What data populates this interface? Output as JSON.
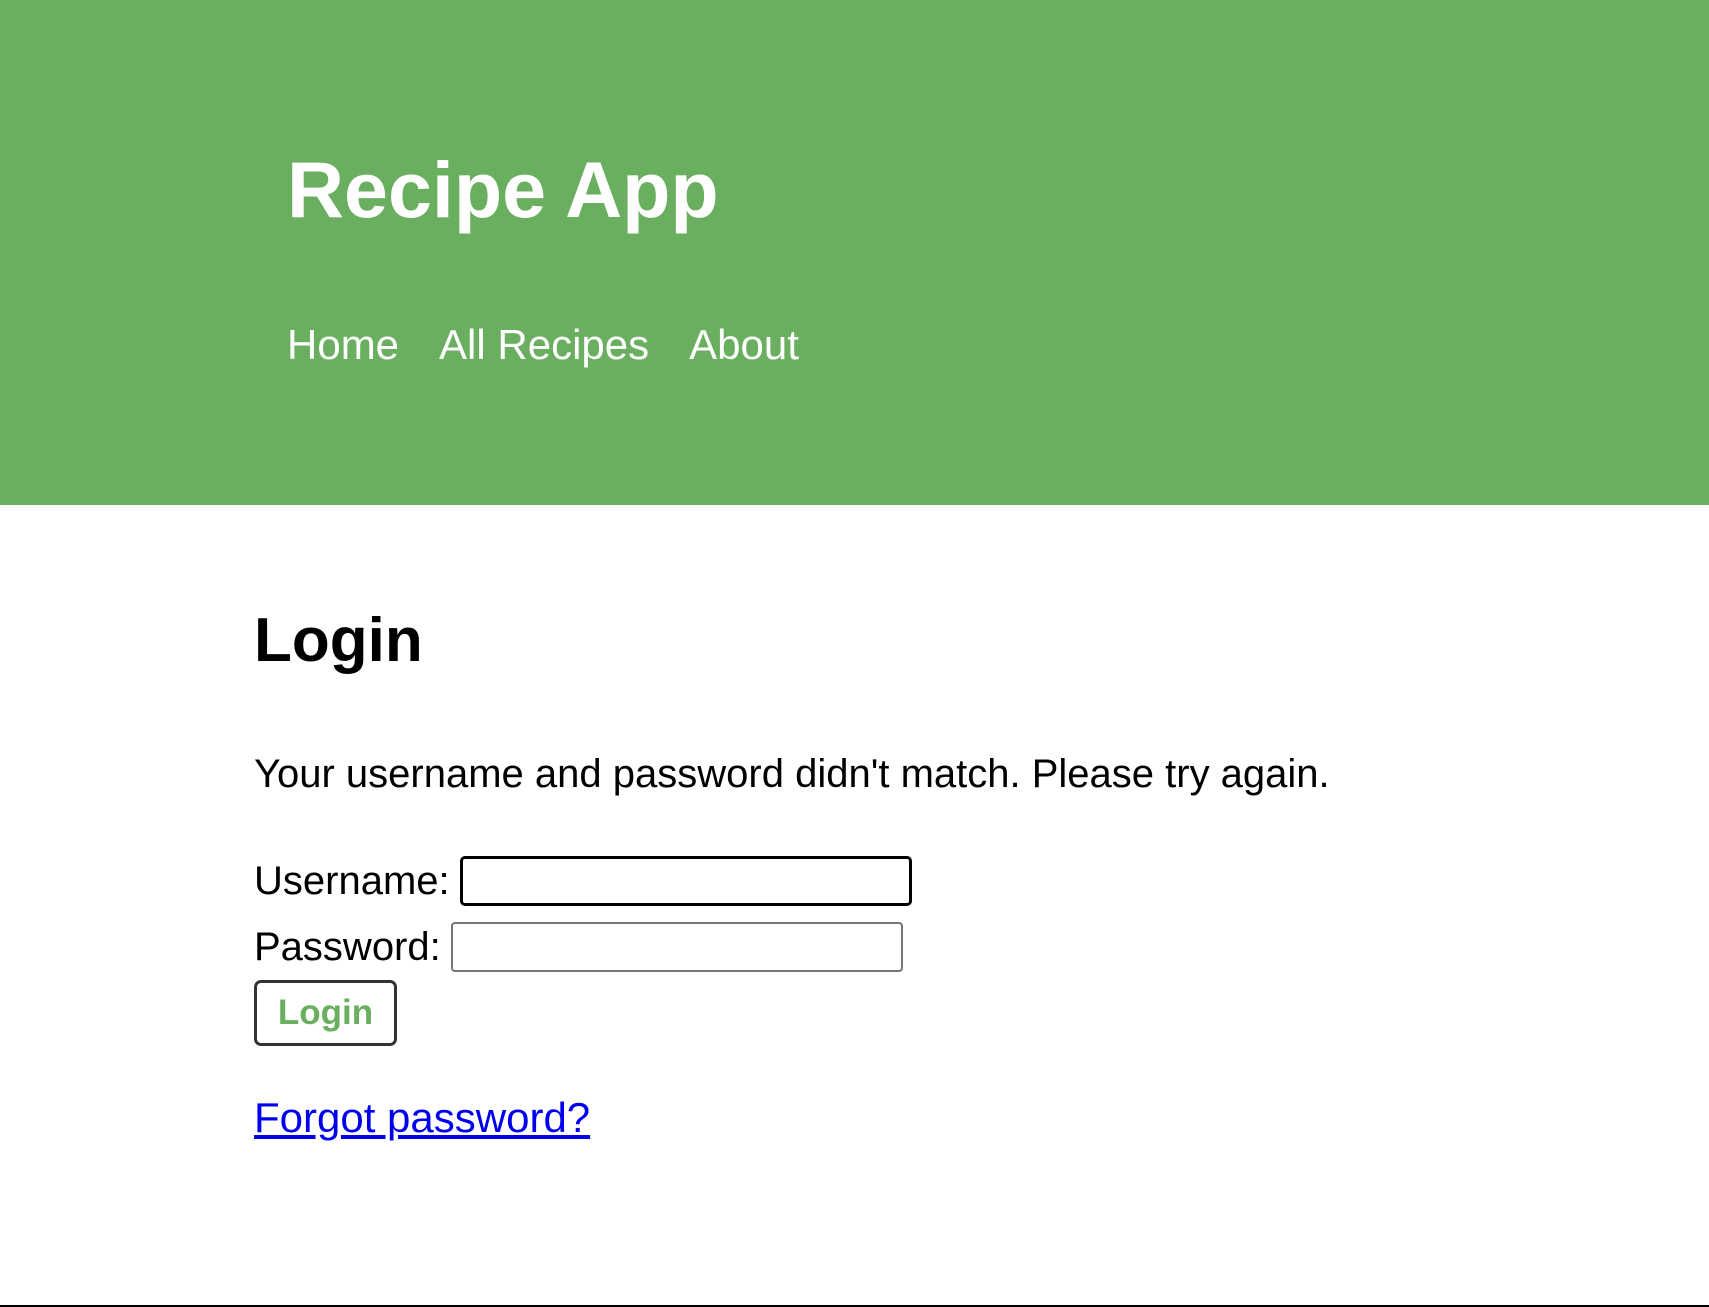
{
  "header": {
    "app_title": "Recipe App",
    "nav": {
      "home": "Home",
      "all_recipes": "All Recipes",
      "about": "About"
    }
  },
  "main": {
    "page_title": "Login",
    "error_message": "Your username and password didn't match. Please try again.",
    "form": {
      "username_label": "Username:",
      "username_value": "",
      "password_label": "Password:",
      "password_value": "",
      "submit_label": "Login"
    },
    "forgot_password_link": "Forgot password?"
  },
  "colors": {
    "header_background": "#6aaf5f",
    "header_text": "#ffffff",
    "button_text": "#6aaf5f",
    "link": "#0000ee"
  }
}
